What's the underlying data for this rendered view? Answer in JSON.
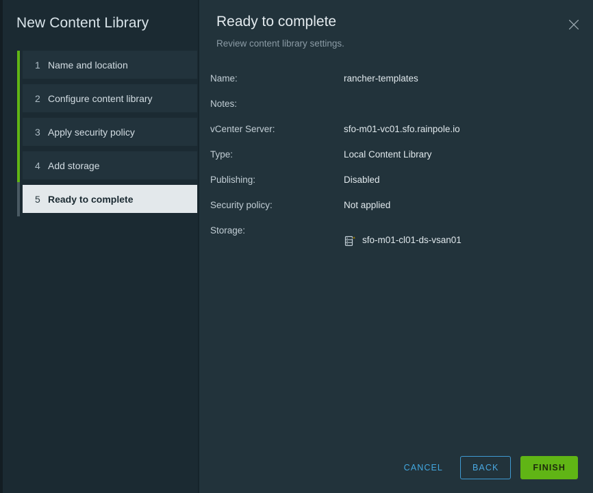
{
  "wizard": {
    "title": "New Content Library"
  },
  "sidebar": {
    "steps": [
      {
        "num": "1",
        "label": "Name and location",
        "active": false
      },
      {
        "num": "2",
        "label": "Configure content library",
        "active": false
      },
      {
        "num": "3",
        "label": "Apply security policy",
        "active": false
      },
      {
        "num": "4",
        "label": "Add storage",
        "active": false
      },
      {
        "num": "5",
        "label": "Ready to complete",
        "active": true
      }
    ]
  },
  "panel": {
    "title": "Ready to complete",
    "subtitle": "Review content library settings.",
    "close_icon": "close-icon"
  },
  "details": [
    {
      "label": "Name:",
      "value": "rancher-templates",
      "icon": ""
    },
    {
      "label": "Notes:",
      "value": "",
      "icon": ""
    },
    {
      "label": "vCenter Server:",
      "value": "sfo-m01-vc01.sfo.rainpole.io",
      "icon": ""
    },
    {
      "label": "Type:",
      "value": "Local Content Library",
      "icon": ""
    },
    {
      "label": "Publishing:",
      "value": "Disabled",
      "icon": ""
    },
    {
      "label": "Security policy:",
      "value": "Not applied",
      "icon": ""
    },
    {
      "label": "Storage:",
      "value": "sfo-m01-cl01-ds-vsan01",
      "icon": "datastore-warning-icon"
    }
  ],
  "footer": {
    "cancel_label": "CANCEL",
    "back_label": "BACK",
    "finish_label": "FINISH"
  },
  "colors": {
    "accent_green": "#60b515",
    "accent_blue": "#42a8e0",
    "warning_yellow": "#fac400",
    "sidebar_bg": "#1b2a32",
    "panel_bg": "#22333b",
    "active_step_bg": "#e3e8eb"
  }
}
